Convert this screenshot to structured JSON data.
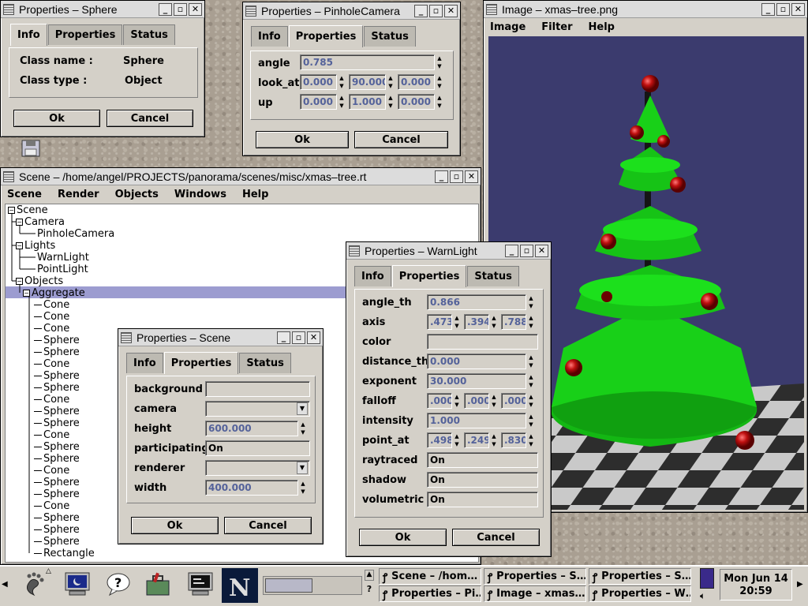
{
  "win_sphere": {
    "title": "Properties – Sphere",
    "tabs": [
      "Info",
      "Properties",
      "Status"
    ],
    "rows": [
      {
        "label": "Class name :",
        "value": "Sphere"
      },
      {
        "label": "Class type :",
        "value": "Object"
      }
    ],
    "ok": "Ok",
    "cancel": "Cancel"
  },
  "win_pinhole": {
    "title": "Properties – PinholeCamera",
    "tabs": [
      "Info",
      "Properties",
      "Status"
    ],
    "angle": {
      "label": "angle",
      "value": "0.785"
    },
    "look_at": {
      "label": "look_at",
      "v1": "0.000",
      "v2": "90.000",
      "v3": "0.000"
    },
    "up": {
      "label": "up",
      "v1": "0.000",
      "v2": "1.000",
      "v3": "0.000"
    },
    "ok": "Ok",
    "cancel": "Cancel"
  },
  "win_image": {
    "title": "Image – xmas–tree.png",
    "menu": [
      "Image",
      "Filter",
      "Help"
    ]
  },
  "win_scene": {
    "title": "Scene – /home/angel/PROJECTS/panorama/scenes/misc/xmas–tree.rt",
    "menu": [
      "Scene",
      "Render",
      "Objects",
      "Windows",
      "Help"
    ],
    "tree": {
      "root": "Scene",
      "camera": "Camera",
      "pinhole": "PinholeCamera",
      "lights": "Lights",
      "warnlight": "WarnLight",
      "pointlight": "PointLight",
      "objects": "Objects",
      "aggregate": "Aggregate",
      "children": [
        "Cone",
        "Cone",
        "Cone",
        "Sphere",
        "Sphere",
        "Cone",
        "Sphere",
        "Sphere",
        "Cone",
        "Sphere",
        "Sphere",
        "Cone",
        "Sphere",
        "Sphere",
        "Cone",
        "Sphere",
        "Sphere",
        "Cone",
        "Sphere",
        "Sphere",
        "Sphere",
        "Rectangle"
      ]
    }
  },
  "win_warn": {
    "title": "Properties – WarnLight",
    "tabs": [
      "Info",
      "Properties",
      "Status"
    ],
    "angle_th": {
      "label": "angle_th",
      "value": "0.866"
    },
    "axis": {
      "label": "axis",
      "v1": ".473",
      "v2": ".394",
      "v3": ".788"
    },
    "color": {
      "label": "color"
    },
    "distance_th": {
      "label": "distance_th",
      "value": "0.000"
    },
    "exponent": {
      "label": "exponent",
      "value": "30.000"
    },
    "falloff": {
      "label": "falloff",
      "v1": ".000",
      "v2": ".000",
      "v3": ".000"
    },
    "intensity": {
      "label": "intensity",
      "value": "1.000"
    },
    "point_at": {
      "label": "point_at",
      "v1": ".498",
      "v2": ".249",
      "v3": ".830"
    },
    "raytraced": {
      "label": "raytraced",
      "value": "On"
    },
    "shadow": {
      "label": "shadow",
      "value": "On"
    },
    "volumetric": {
      "label": "volumetric",
      "value": "On"
    },
    "ok": "Ok",
    "cancel": "Cancel"
  },
  "win_scene_props": {
    "title": "Properties – Scene",
    "tabs": [
      "Info",
      "Properties",
      "Status"
    ],
    "background": {
      "label": "background"
    },
    "camera": {
      "label": "camera"
    },
    "height": {
      "label": "height",
      "value": "600.000"
    },
    "participating": {
      "label": "participating",
      "value": "On"
    },
    "renderer": {
      "label": "renderer"
    },
    "width": {
      "label": "width",
      "value": "400.000"
    },
    "ok": "Ok",
    "cancel": "Cancel"
  },
  "taskbar": {
    "tasks": [
      "Scene – /hom…",
      "Properties – S…",
      "Properties – S…",
      "Properties – Pi…",
      "Image – xmas…",
      "Properties – W…"
    ],
    "clock_date": "Mon Jun 14",
    "clock_time": "20:59",
    "help": "?"
  },
  "colors": {
    "window_bg": "#d4d0c8",
    "selection": "#9c9cd0",
    "render_bg": "#3b3b6e",
    "tree_green": "#12c412",
    "ornament_red": "#c01010"
  }
}
